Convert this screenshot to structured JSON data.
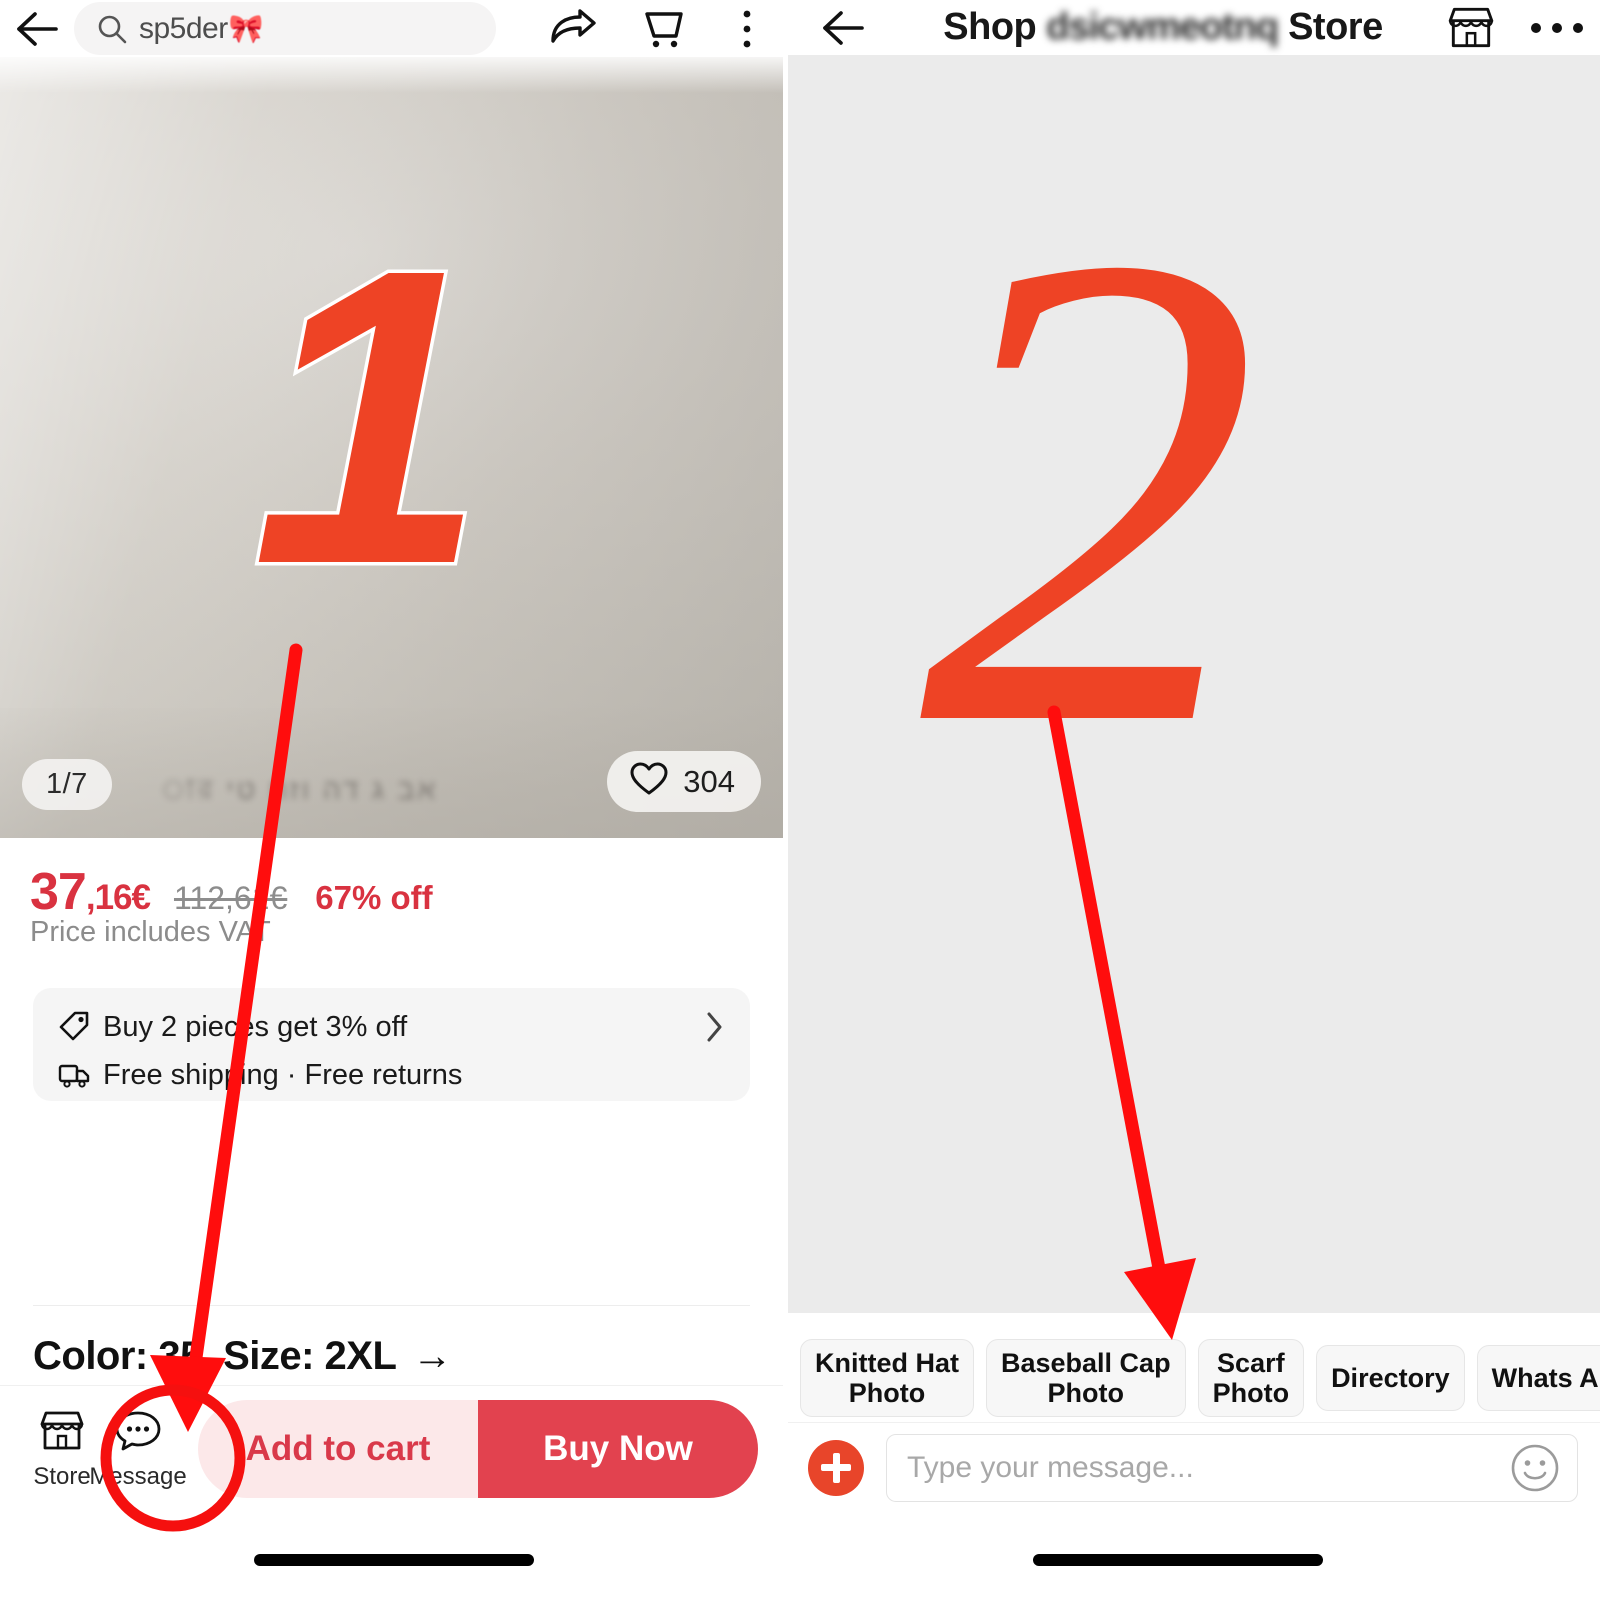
{
  "left_panel": {
    "topbar": {
      "back_icon": "back-arrow-icon",
      "search_value": "sp5der",
      "search_emoji": "🎀",
      "share_icon": "share-icon",
      "cart_icon": "cart-icon",
      "more_icon": "more-vertical-icon"
    },
    "hero": {
      "image_counter": "1/7",
      "blurred_caption": "blurred watermark text",
      "like_icon": "heart-icon",
      "like_count": "304"
    },
    "price": {
      "current_whole": "37",
      "current_fraction": ",16€",
      "original": "112,61€",
      "discount": "67% off",
      "vat_note": "Price includes VAT"
    },
    "promo": {
      "tag_icon": "price-tag-icon",
      "line1": "Buy 2 pieces get 3% off",
      "chevron_icon": "chevron-right-icon",
      "truck_icon": "delivery-truck-icon",
      "line2": "Free shipping · Free returns"
    },
    "variant_row": "Color: 35, Size: 2XL",
    "variant_arrow": "→",
    "bottom_bar": {
      "store_icon": "storefront-icon",
      "store_label": "Store",
      "message_icon": "message-bubble-icon",
      "message_label": "Message",
      "add_to_cart_label": "Add to cart",
      "buy_now_label": "Buy Now"
    }
  },
  "right_panel": {
    "topbar": {
      "back_icon": "back-arrow-icon",
      "title_prefix": "Shop",
      "title_blurred": "dsicwmeotnq",
      "title_suffix": "Store",
      "store_icon": "storefront-icon",
      "more_icon": "more-horizontal-icon"
    },
    "quick_replies": [
      {
        "label": "Knitted Hat\nPhoto"
      },
      {
        "label": "Baseball Cap\nPhoto"
      },
      {
        "label": "Scarf\nPhoto"
      },
      {
        "label": "Directory"
      },
      {
        "label": "Whats App"
      }
    ],
    "message_bar": {
      "plus_icon": "plus-icon",
      "placeholder": "Type your message...",
      "value": "",
      "emoji_icon": "smiley-icon"
    }
  },
  "annotations": {
    "step_one": "1",
    "step_two": "2",
    "arrow_color": "#FF0D0D",
    "numeral_color": "#EE4325",
    "circle_target": "message-button"
  }
}
